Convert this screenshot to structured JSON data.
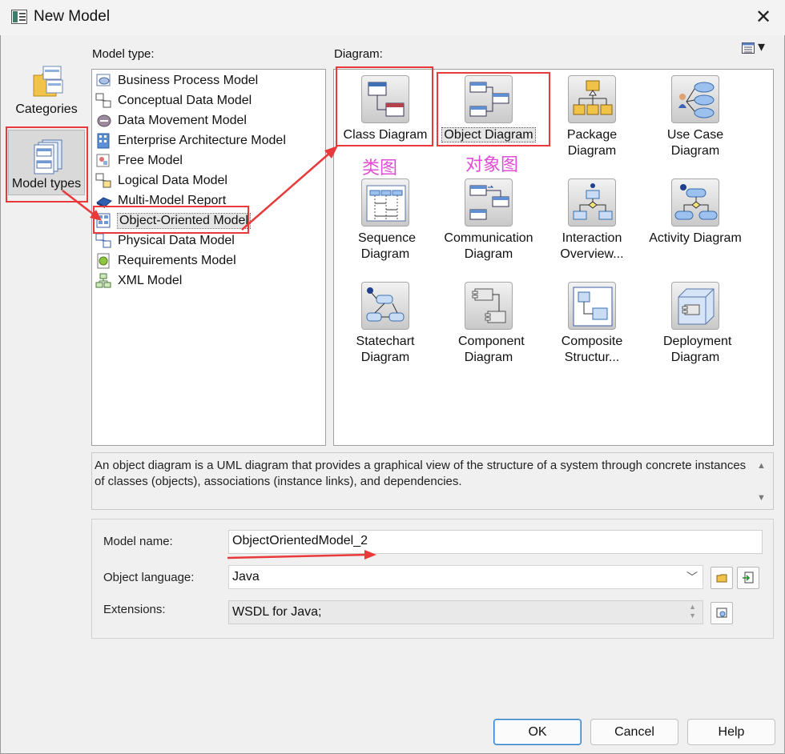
{
  "window": {
    "title": "New Model",
    "close": "✕"
  },
  "categories": [
    {
      "label": "Categories",
      "icon": "folder-icon"
    },
    {
      "label": "Model types",
      "icon": "model-types-icon",
      "selected": true
    }
  ],
  "model_type": {
    "label": "Model type:",
    "items": [
      {
        "label": "Business Process Model",
        "icon": "business-process-icon"
      },
      {
        "label": "Conceptual Data Model",
        "icon": "conceptual-data-icon"
      },
      {
        "label": "Data Movement Model",
        "icon": "data-movement-icon"
      },
      {
        "label": "Enterprise Architecture Model",
        "icon": "enterprise-architecture-icon"
      },
      {
        "label": "Free Model",
        "icon": "free-model-icon"
      },
      {
        "label": "Logical Data Model",
        "icon": "logical-data-icon"
      },
      {
        "label": "Multi-Model Report",
        "icon": "multi-model-report-icon"
      },
      {
        "label": "Object-Oriented Model",
        "icon": "object-oriented-icon",
        "selected": true
      },
      {
        "label": "Physical Data Model",
        "icon": "physical-data-icon"
      },
      {
        "label": "Requirements Model",
        "icon": "requirements-icon"
      },
      {
        "label": "XML Model",
        "icon": "xml-model-icon"
      }
    ]
  },
  "diagram": {
    "label": "Diagram:",
    "view_toggle": "▾",
    "items": [
      {
        "label": "Class Diagram",
        "icon": "class-diagram-icon"
      },
      {
        "label": "Object Diagram",
        "icon": "object-diagram-icon",
        "selected": true
      },
      {
        "label": "Package Diagram",
        "icon": "package-diagram-icon"
      },
      {
        "label": "Use Case Diagram",
        "icon": "use-case-diagram-icon"
      },
      {
        "label": "Sequence Diagram",
        "icon": "sequence-diagram-icon"
      },
      {
        "label": "Communication Diagram",
        "icon": "communication-diagram-icon"
      },
      {
        "label": "Interaction Overview...",
        "icon": "interaction-overview-icon"
      },
      {
        "label": "Activity Diagram",
        "icon": "activity-diagram-icon"
      },
      {
        "label": "Statechart Diagram",
        "icon": "statechart-diagram-icon"
      },
      {
        "label": "Component Diagram",
        "icon": "component-diagram-icon"
      },
      {
        "label": "Composite Structur...",
        "icon": "composite-structure-icon"
      },
      {
        "label": "Deployment Diagram",
        "icon": "deployment-diagram-icon"
      }
    ]
  },
  "description": "An object diagram is a UML diagram that provides a graphical view of the structure of a system through concrete instances of classes (objects), associations (instance links), and dependencies.",
  "properties": {
    "model_name_label": "Model name:",
    "model_name_value": "ObjectOrientedModel_2",
    "object_language_label": "Object language:",
    "object_language_value": "Java",
    "extensions_label": "Extensions:",
    "extensions_value": "WSDL for Java;"
  },
  "buttons": {
    "ok": "OK",
    "cancel": "Cancel",
    "help": "Help"
  },
  "annotations": {
    "class_note": "类图",
    "object_note": "对象图",
    "color": "#e83a3a",
    "note_color": "#e24cd6"
  }
}
